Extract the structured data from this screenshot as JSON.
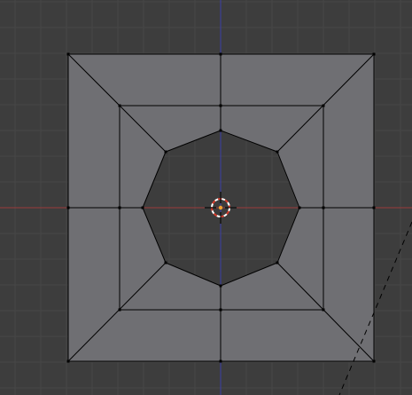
{
  "viewport": {
    "view": "top-orthographic",
    "colors": {
      "background": "#3d3d3d",
      "grid": "#474747",
      "x_axis": "#9a3a3a",
      "y_axis": "#3c3fa8",
      "face": "#6f6f73",
      "edge": "#000000",
      "vertex": "#000000",
      "hole": "#3d3d3d",
      "cursor_ring_a": "#ffffff",
      "cursor_ring_b": "#d83a2a",
      "cursor_center": "#f0a030"
    }
  },
  "mesh": {
    "type": "square-frame-with-octagon-hole",
    "rings": 3,
    "octagon_sides": 8
  },
  "cursor_3d": {
    "icon": "3d-cursor-icon"
  },
  "relationship_line": {
    "style": "dashed"
  }
}
